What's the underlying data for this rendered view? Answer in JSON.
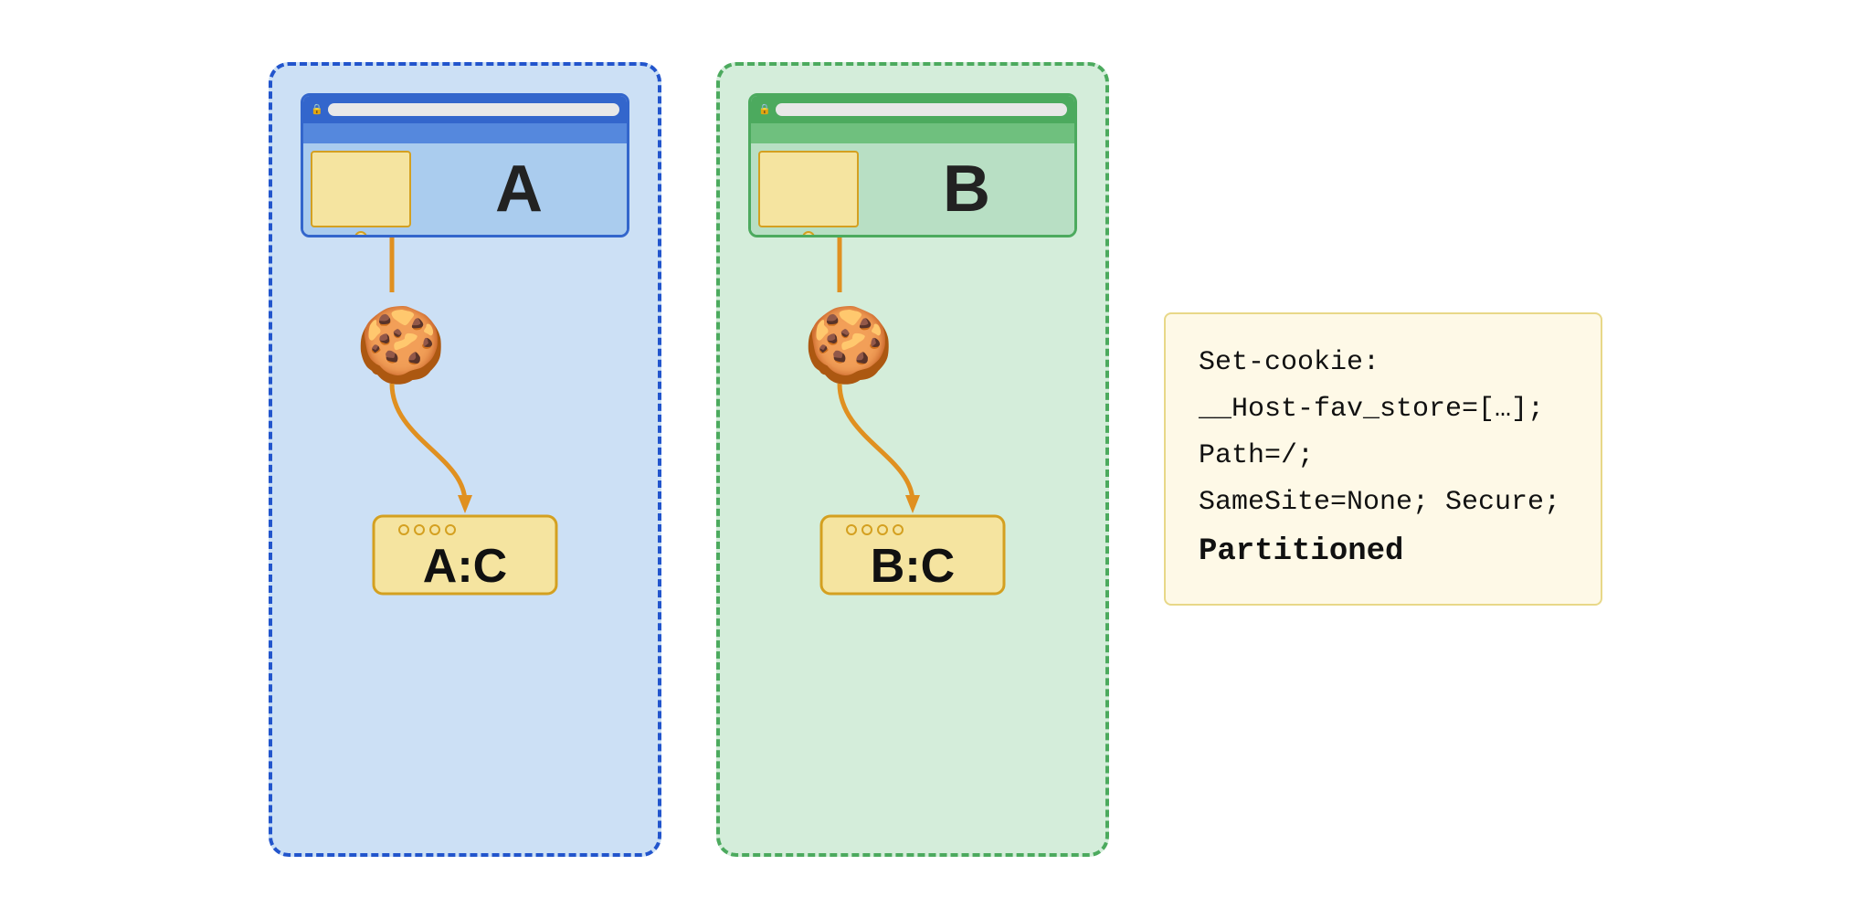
{
  "partitionA": {
    "browserLabel": "A",
    "storageLabel": "A:C",
    "color": "blue"
  },
  "partitionB": {
    "browserLabel": "B",
    "storageLabel": "B:C",
    "color": "green"
  },
  "codeBox": {
    "line1": "Set-cookie:",
    "line2": "__Host-fav_store=[…];",
    "line3": "Path=/;",
    "line4": "SameSite=None; Secure;",
    "line5": "Partitioned"
  }
}
